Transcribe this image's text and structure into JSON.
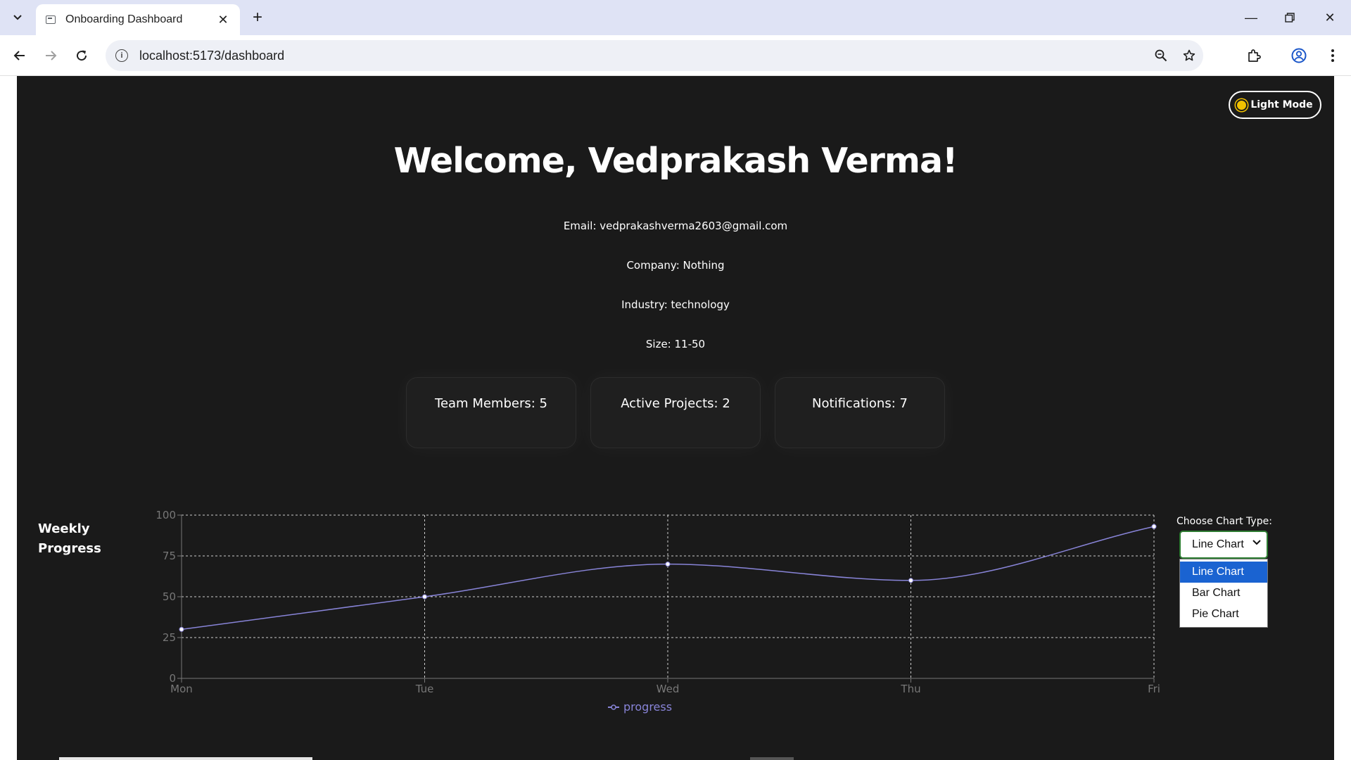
{
  "browser": {
    "tab_title": "Onboarding Dashboard",
    "url": "localhost:5173/dashboard"
  },
  "page": {
    "mode_button": "Light Mode",
    "welcome": "Welcome, Vedprakash Verma!",
    "email": "Email: vedprakashverma2603@gmail.com",
    "company": "Company: Nothing",
    "industry": "Industry: technology",
    "size": "Size: 11-50",
    "cards": [
      {
        "label": "Team Members: 5"
      },
      {
        "label": "Active Projects: 2"
      },
      {
        "label": "Notifications: 7"
      }
    ],
    "chart_heading": "Weekly Progress",
    "chart_type_label": "Choose Chart Type:",
    "chart_type_selected": "Line Chart",
    "chart_type_options": [
      "Line Chart",
      "Bar Chart",
      "Pie Chart"
    ]
  },
  "colors": {
    "background": "#1a1a1a",
    "line": "#8884d8",
    "grid": "#cccccc",
    "option_highlight": "#1a63d1"
  },
  "chart_data": {
    "type": "line",
    "categories": [
      "Mon",
      "Tue",
      "Wed",
      "Thu",
      "Fri"
    ],
    "series": [
      {
        "name": "progress",
        "values": [
          30,
          50,
          70,
          60,
          93
        ]
      }
    ],
    "yticks": [
      0,
      25,
      50,
      75,
      100
    ],
    "ylim": [
      0,
      100
    ],
    "grid": true,
    "legend": "bottom"
  }
}
